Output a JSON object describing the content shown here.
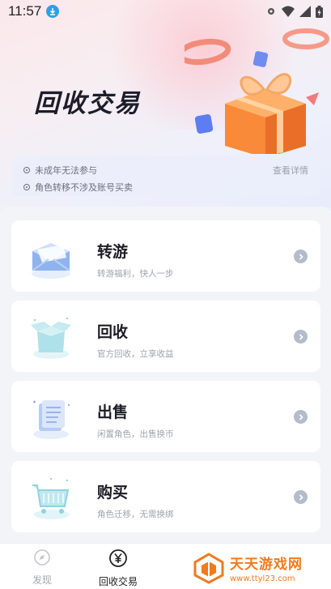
{
  "status_bar": {
    "time": "11:57"
  },
  "header": {
    "title": "回收交易"
  },
  "notice": {
    "items": [
      "未成年无法参与",
      "角色转移不涉及账号买卖"
    ],
    "detail_link": "查看详情"
  },
  "cards": [
    {
      "title": "转游",
      "subtitle": "转游福利，快人一步",
      "icon": "envelope-icon"
    },
    {
      "title": "回收",
      "subtitle": "官方回收，立享收益",
      "icon": "open-box-icon"
    },
    {
      "title": "出售",
      "subtitle": "闲置角色，出售换币",
      "icon": "document-icon"
    },
    {
      "title": "购买",
      "subtitle": "角色迁移，无需换绑",
      "icon": "shopping-cart-icon"
    }
  ],
  "bottom_nav": {
    "items": [
      {
        "label": "发现",
        "active": false
      },
      {
        "label": "回收交易",
        "active": true
      }
    ]
  },
  "watermark": {
    "name": "天天游戏网",
    "url": "www.ttyl23.com"
  },
  "colors": {
    "accent_orange": "#f07a1e",
    "arrow_gray": "#b4bccb"
  }
}
